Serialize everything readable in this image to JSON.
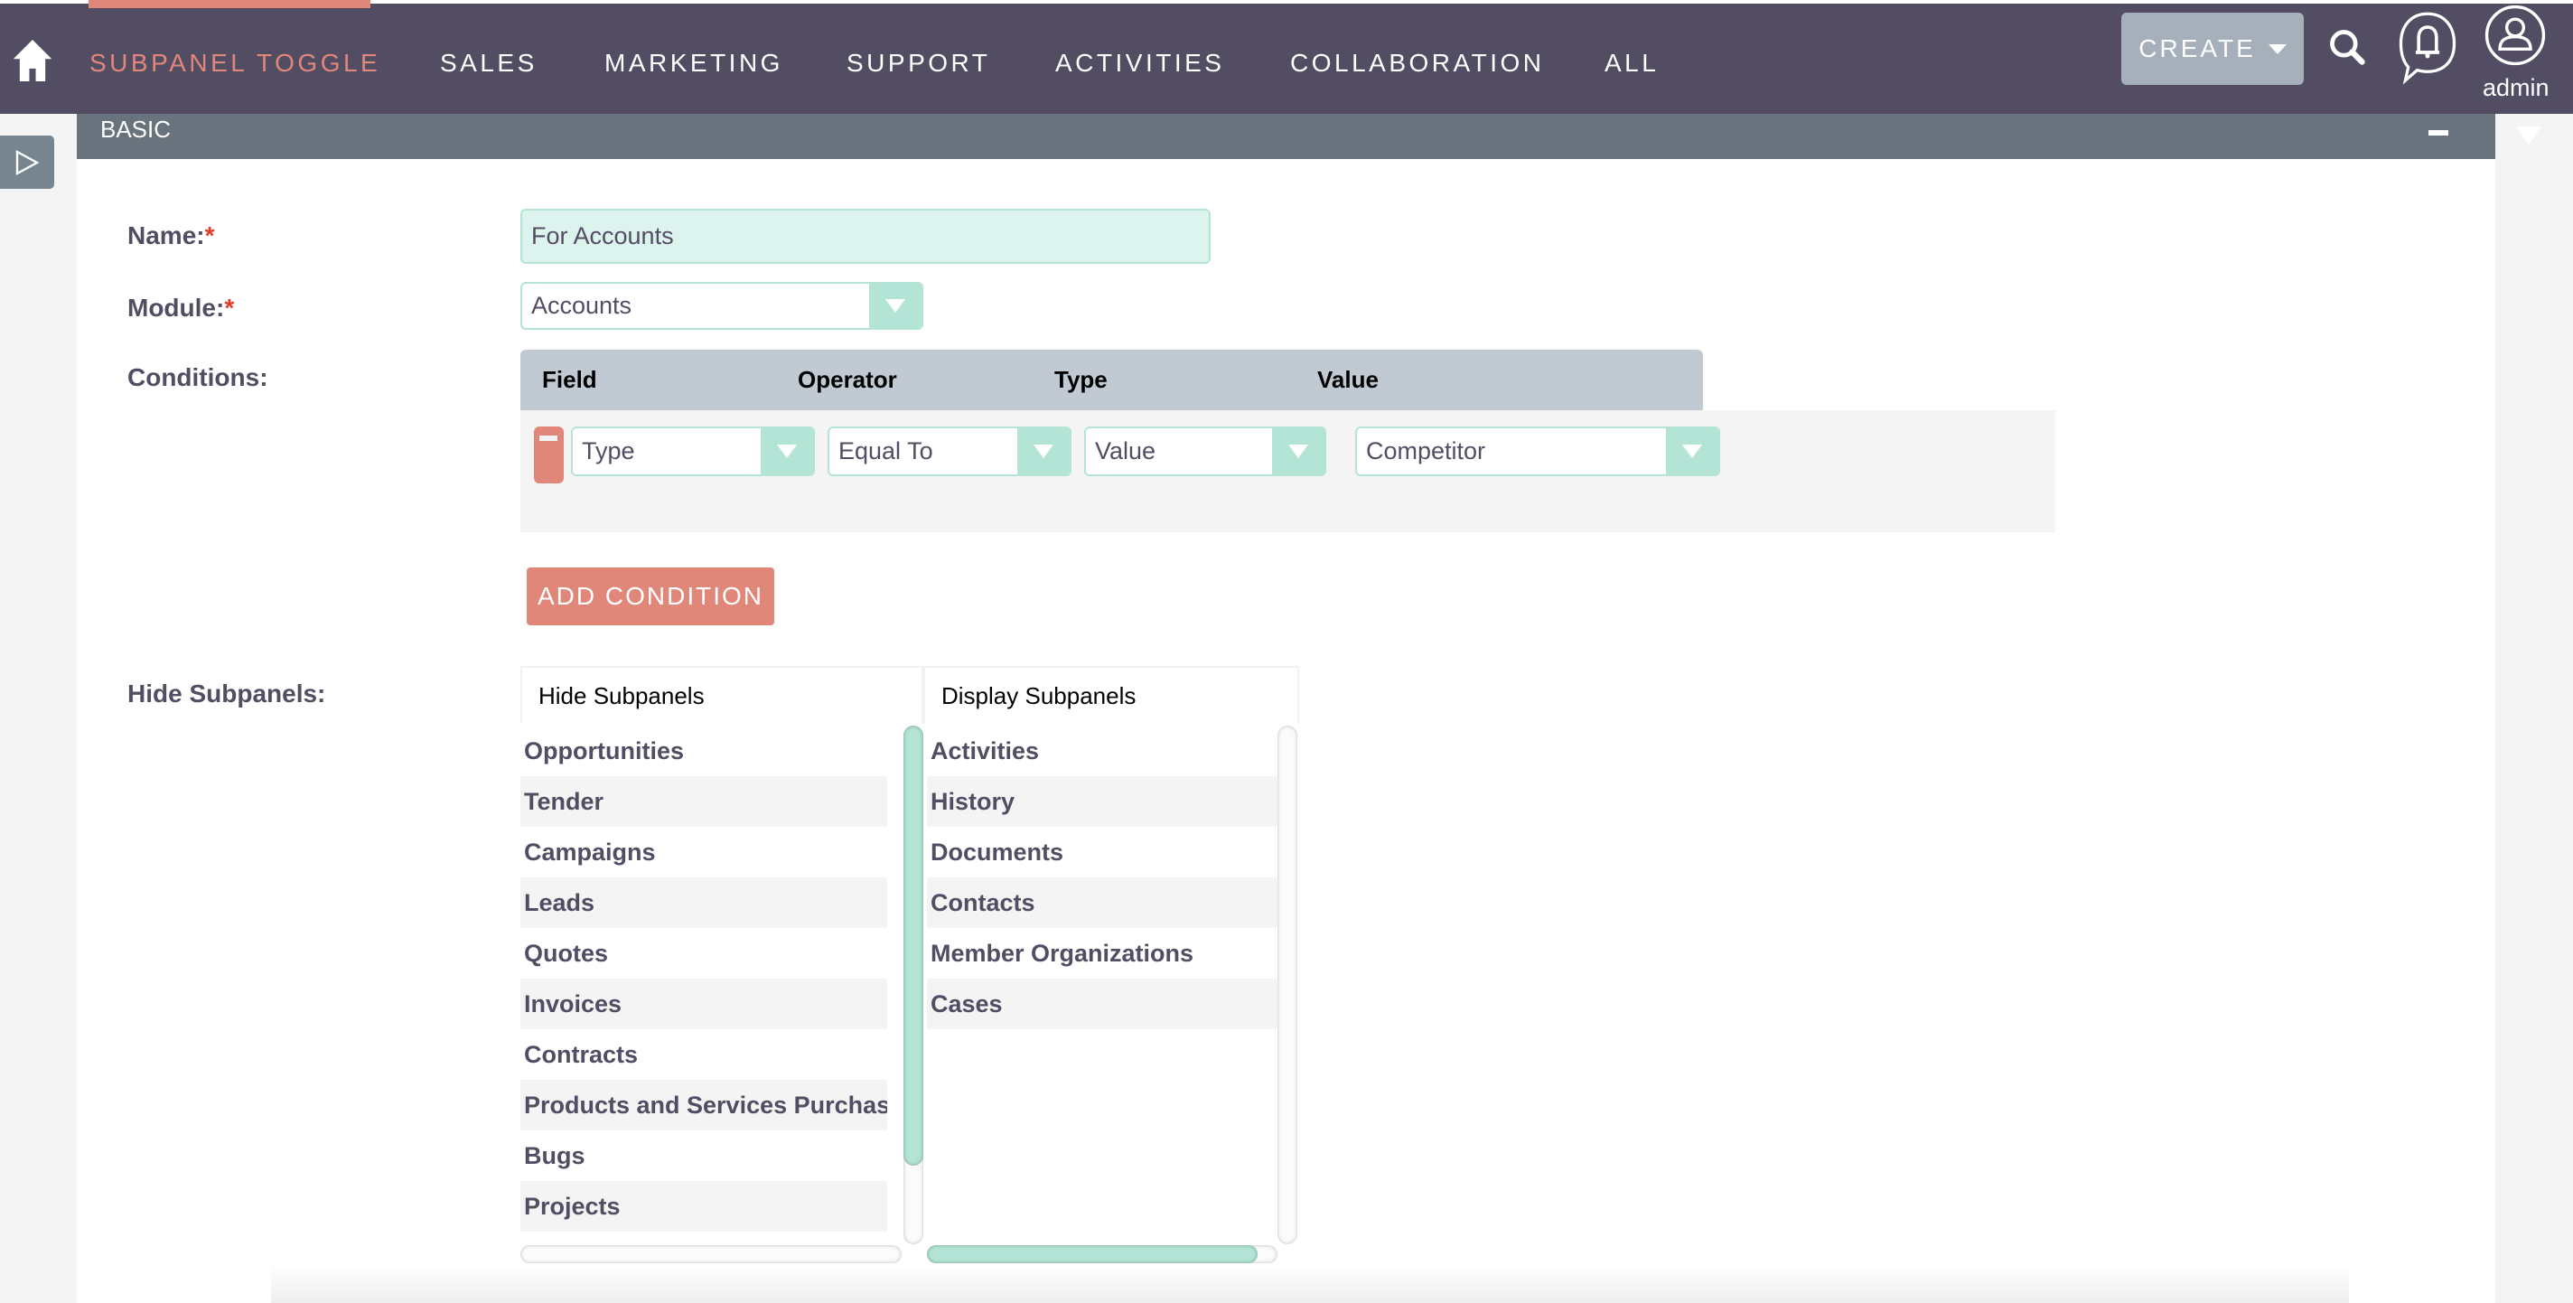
{
  "nav": {
    "items": [
      {
        "label": "SUBPANEL TOGGLE",
        "active": true
      },
      {
        "label": "SALES"
      },
      {
        "label": "MARKETING"
      },
      {
        "label": "SUPPORT"
      },
      {
        "label": "ACTIVITIES"
      },
      {
        "label": "COLLABORATION"
      },
      {
        "label": "ALL"
      }
    ],
    "create_label": "CREATE",
    "user_label": "admin"
  },
  "panel": {
    "title": "BASIC"
  },
  "form": {
    "name_label": "Name:",
    "name_value": "For Accounts",
    "module_label": "Module:",
    "module_value": "Accounts",
    "conditions_label": "Conditions:",
    "required_mark": "*",
    "hide_label": "Hide Subpanels:"
  },
  "conditions": {
    "columns": [
      "Field",
      "Operator",
      "Type",
      "Value"
    ],
    "rows": [
      {
        "field": "Type",
        "operator": "Equal To",
        "type": "Value",
        "value": "Competitor"
      }
    ],
    "add_label": "ADD CONDITION"
  },
  "subpanels": {
    "hide_header": "Hide Subpanels",
    "display_header": "Display Subpanels",
    "hide_items": [
      "Opportunities",
      "Tender",
      "Campaigns",
      "Leads",
      "Quotes",
      "Invoices",
      "Contracts",
      "Products and Services Purchased",
      "Bugs",
      "Projects"
    ],
    "display_items": [
      "Activities",
      "History",
      "Documents",
      "Contacts",
      "Member Organizations",
      "Cases"
    ]
  },
  "colors": {
    "nav_bg": "#534d64",
    "accent": "#e0877a",
    "teal": "#b3e4d6",
    "panel_header": "#68737d"
  }
}
